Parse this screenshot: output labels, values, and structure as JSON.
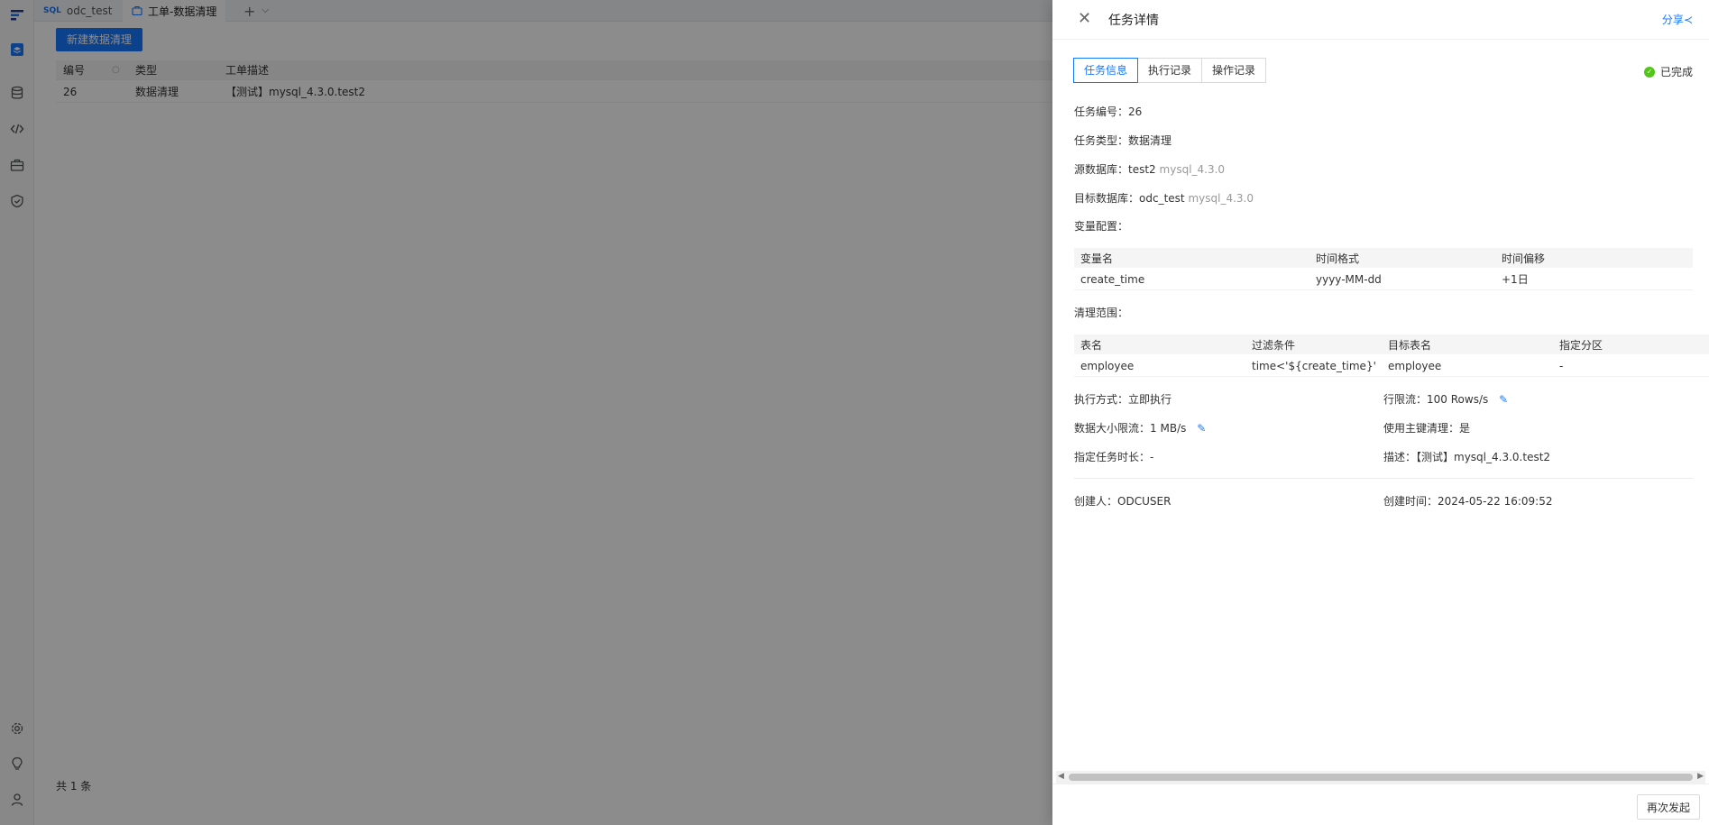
{
  "sidebar": {
    "icons": [
      "logo-icon",
      "layers-icon",
      "database-icon",
      "code-icon",
      "briefcase-icon",
      "shield-icon",
      "gear-icon",
      "bulb-icon",
      "user-icon"
    ]
  },
  "tabs": [
    {
      "tag": "SQL",
      "label": "odc_test"
    },
    {
      "label": "工单-数据清理"
    }
  ],
  "toolbar": {
    "new_button": "新建数据清理"
  },
  "list": {
    "columns": [
      "编号",
      "类型",
      "工单描述"
    ],
    "rows": [
      {
        "id": "26",
        "type": "数据清理",
        "desc": "【测试】mysql_4.3.0.test2"
      }
    ],
    "footer": "共 1 条"
  },
  "drawer": {
    "title": "任务详情",
    "share": "分享",
    "tabs": [
      "任务信息",
      "执行记录",
      "操作记录"
    ],
    "status": "已完成",
    "fields": {
      "task_id_label": "任务编号：",
      "task_id": "26",
      "task_type_label": "任务类型：",
      "task_type": "数据清理",
      "source_db_label": "源数据库：",
      "source_db": "test2",
      "source_db_ver": "mysql_4.3.0",
      "target_db_label": "目标数据库：",
      "target_db": "odc_test",
      "target_db_ver": "mysql_4.3.0",
      "var_config_label": "变量配置：",
      "clean_range_label": "清理范围：",
      "exec_mode_label": "执行方式：",
      "exec_mode": "立即执行",
      "row_limit_label": "行限流：",
      "row_limit": "100",
      "row_limit_unit": "Rows/s",
      "data_limit_label": "数据大小限流：",
      "data_limit": "1",
      "data_limit_unit": "MB/s",
      "use_pk_label": "使用主键清理：",
      "use_pk": "是",
      "duration_label": "指定任务时长：",
      "duration": "-",
      "desc_label": "描述：",
      "desc": "【测试】mysql_4.3.0.test2",
      "creator_label": "创建人：",
      "creator": "ODCUSER",
      "created_label": "创建时间：",
      "created": "2024-05-22 16:09:52"
    },
    "var_table": {
      "columns": [
        "变量名",
        "时间格式",
        "时间偏移"
      ],
      "rows": [
        [
          "create_time",
          "yyyy-MM-dd",
          "+1日"
        ]
      ]
    },
    "range_table": {
      "columns": [
        "表名",
        "过滤条件",
        "目标表名",
        "指定分区"
      ],
      "rows": [
        [
          "employee",
          "time<'${create_time}'",
          "employee",
          "-"
        ]
      ]
    },
    "footer_button": "再次发起"
  }
}
